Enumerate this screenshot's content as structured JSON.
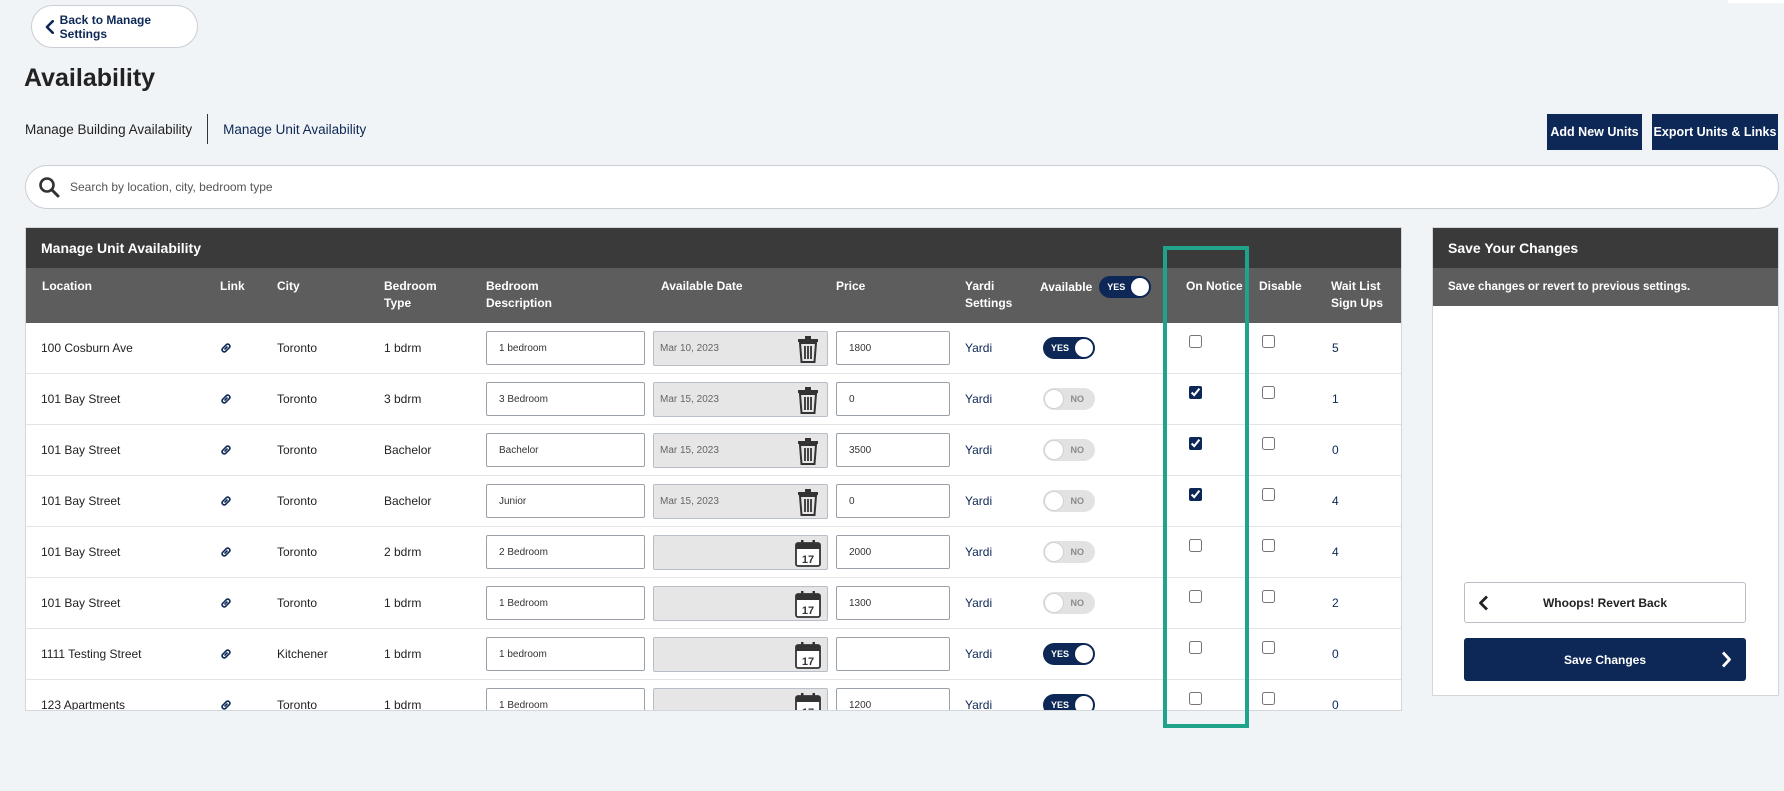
{
  "back_button": {
    "label": "Back to Manage Settings"
  },
  "page_title": "Availability",
  "subnav": {
    "tabs": [
      "Manage Building Availability",
      "Manage Unit Availability"
    ],
    "active_index": 1
  },
  "buttons": {
    "add_units": "Add New Units",
    "export": "Export Units & Links"
  },
  "search": {
    "placeholder": "Search by location, city, bedroom type",
    "value": ""
  },
  "table": {
    "title": "Manage Unit Availability",
    "headers": {
      "location": "Location",
      "link": "Link",
      "city": "City",
      "bedroom_type_1": "Bedroom",
      "bedroom_type_2": "Type",
      "bedroom_desc_1": "Bedroom",
      "bedroom_desc_2": "Description",
      "available_date": "Available Date",
      "price": "Price",
      "yardi_1": "Yardi",
      "yardi_2": "Settings",
      "available": "Available",
      "available_toggle": "YES",
      "on_notice": "On Notice",
      "disable": "Disable",
      "wait_list_1": "Wait List",
      "wait_list_2": "Sign Ups"
    },
    "rows": [
      {
        "location": "100 Cosburn Ave",
        "city": "Toronto",
        "bedroom_type": "1 bdrm",
        "description": "1 bedroom",
        "date": "Mar 10, 2023",
        "date_icon": "trash-icon",
        "price": "1800",
        "yardi": "Yardi",
        "available": true,
        "available_label": "YES",
        "on_notice": false,
        "disable": false,
        "wait_list": "5"
      },
      {
        "location": "101 Bay Street",
        "city": "Toronto",
        "bedroom_type": "3 bdrm",
        "description": "3 Bedroom",
        "date": "Mar 15, 2023",
        "date_icon": "trash-icon",
        "price": "0",
        "yardi": "Yardi",
        "available": false,
        "available_label": "NO",
        "on_notice": true,
        "disable": false,
        "wait_list": "1"
      },
      {
        "location": "101 Bay Street",
        "city": "Toronto",
        "bedroom_type": "Bachelor",
        "description": "Bachelor",
        "date": "Mar 15, 2023",
        "date_icon": "trash-icon",
        "price": "3500",
        "yardi": "Yardi",
        "available": false,
        "available_label": "NO",
        "on_notice": true,
        "disable": false,
        "wait_list": "0"
      },
      {
        "location": "101 Bay Street",
        "city": "Toronto",
        "bedroom_type": "Bachelor",
        "description": "Junior",
        "date": "Mar 15, 2023",
        "date_icon": "trash-icon",
        "price": "0",
        "yardi": "Yardi",
        "available": false,
        "available_label": "NO",
        "on_notice": true,
        "disable": false,
        "wait_list": "4"
      },
      {
        "location": "101 Bay Street",
        "city": "Toronto",
        "bedroom_type": "2 bdrm",
        "description": "2 Bedroom",
        "date": "",
        "date_icon": "calendar-icon",
        "price": "2000",
        "yardi": "Yardi",
        "available": false,
        "available_label": "NO",
        "on_notice": false,
        "disable": false,
        "wait_list": "4"
      },
      {
        "location": "101 Bay Street",
        "city": "Toronto",
        "bedroom_type": "1 bdrm",
        "description": "1 Bedroom",
        "date": "",
        "date_icon": "calendar-icon",
        "price": "1300",
        "yardi": "Yardi",
        "available": false,
        "available_label": "NO",
        "on_notice": false,
        "disable": false,
        "wait_list": "2"
      },
      {
        "location": "1111 Testing Street",
        "city": "Kitchener",
        "bedroom_type": "1 bdrm",
        "description": "1 bedroom",
        "date": "",
        "date_icon": "calendar-icon",
        "price": "",
        "yardi": "Yardi",
        "available": true,
        "available_label": "YES",
        "on_notice": false,
        "disable": false,
        "wait_list": "0"
      },
      {
        "location": "123 Apartments",
        "city": "Toronto",
        "bedroom_type": "1 bdrm",
        "description": "1 Bedroom",
        "date": "",
        "date_icon": "calendar-icon",
        "price": "1200",
        "yardi": "Yardi",
        "available": true,
        "available_label": "YES",
        "on_notice": false,
        "disable": false,
        "wait_list": "0"
      }
    ],
    "calendar_day": "17"
  },
  "side_panel": {
    "title": "Save Your Changes",
    "subtitle": "Save changes or revert to previous settings.",
    "revert_label": "Whoops! Revert Back",
    "save_label": "Save Changes"
  },
  "colors": {
    "navy": "#0d2856",
    "header_dark": "#3a3a3a",
    "header_mid": "#5d5d5d",
    "highlight": "#1fa38a",
    "background": "#f1f4f7"
  }
}
